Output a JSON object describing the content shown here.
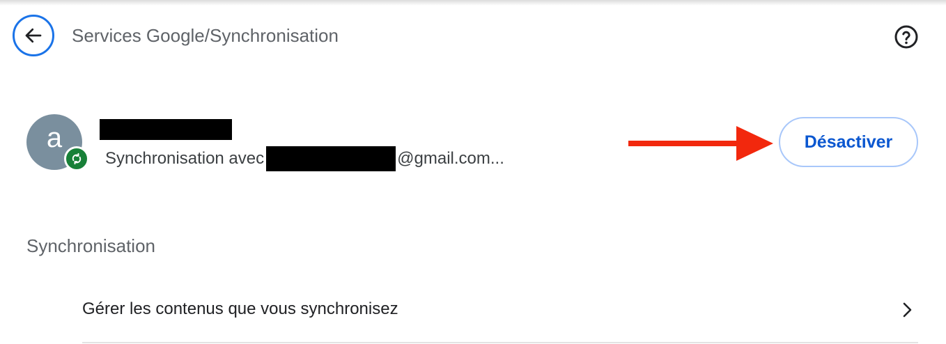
{
  "header": {
    "title": "Services Google/Synchronisation",
    "back_icon": "arrow-back-icon",
    "help_icon": "help-circle-icon"
  },
  "account": {
    "avatar_letter": "a",
    "avatar_color": "#7a8f9e",
    "sync_badge_color": "#188038",
    "sync_prefix": "Synchronisation avec",
    "sync_suffix": "@gmail.com..."
  },
  "annotation": {
    "arrow_color": "#f2280d"
  },
  "actions": {
    "deactivate_label": "Désactiver",
    "accent": "#0b57d0"
  },
  "sync_section": {
    "title": "Synchronisation",
    "manage_label": "Gérer les contenus que vous synchronisez"
  }
}
